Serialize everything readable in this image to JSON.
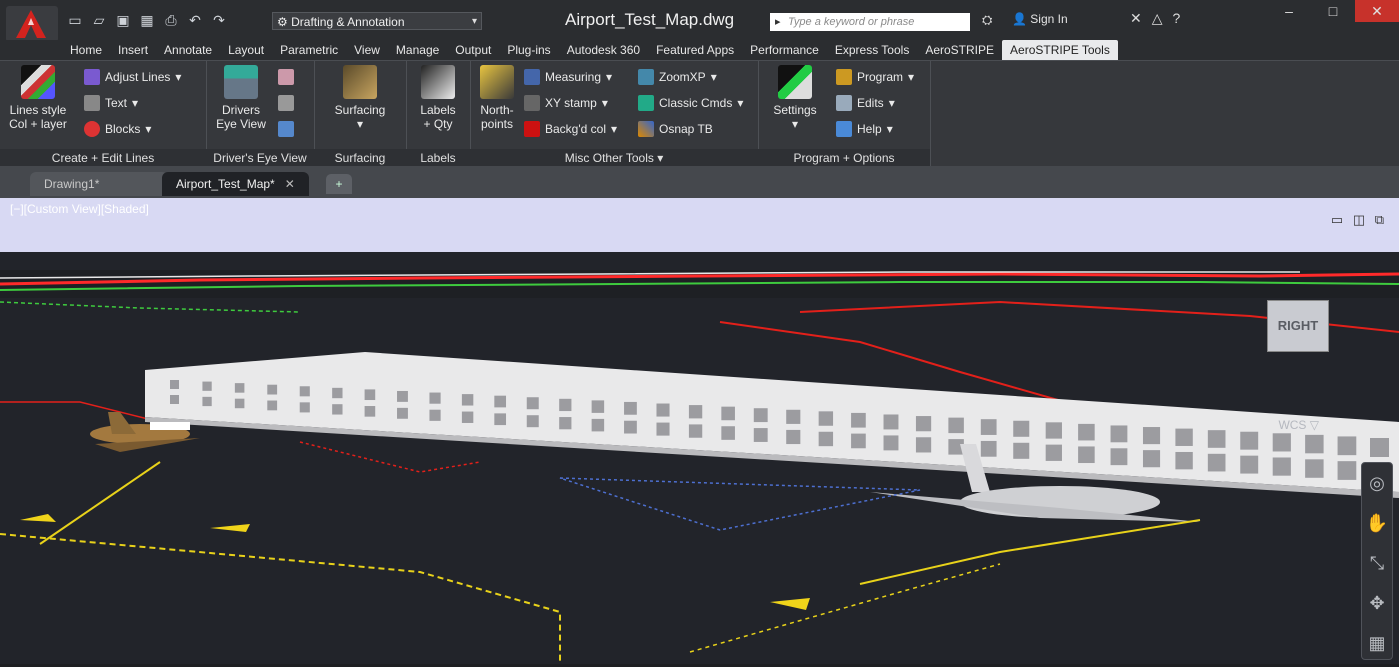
{
  "titlebar": {
    "workspace": "Drafting & Annotation",
    "doc_title": "Airport_Test_Map.dwg",
    "search_placeholder": "Type a keyword or phrase",
    "signin": "Sign In"
  },
  "ribbon_tabs": [
    "Home",
    "Insert",
    "Annotate",
    "Layout",
    "Parametric",
    "View",
    "Manage",
    "Output",
    "Plug-ins",
    "Autodesk 360",
    "Featured Apps",
    "Performance",
    "Express Tools",
    "AeroSTRIPE",
    "AeroSTRIPE Tools"
  ],
  "active_tab": "AeroSTRIPE Tools",
  "panels": {
    "create_edit": {
      "label": "Create + Edit Lines",
      "big_label_1": "Lines style",
      "big_label_2": "Col + layer",
      "adjust": "Adjust Lines",
      "text": "Text",
      "blocks": "Blocks"
    },
    "drivers": {
      "label": "Driver's Eye View",
      "big_label_1": "Drivers",
      "big_label_2": "Eye View"
    },
    "surfacing": {
      "label": "Surfacing",
      "big_label": "Surfacing"
    },
    "labels": {
      "label": "Labels",
      "big_label_1": "Labels",
      "big_label_2": "+ Qty"
    },
    "misc": {
      "label": "Misc Other Tools",
      "big_label_1": "North-",
      "big_label_2": "points",
      "measuring": "Measuring",
      "xystamp": "XY stamp",
      "backgd": "Backg'd col",
      "zoomxp": "ZoomXP",
      "classic": "Classic Cmds",
      "osnap": "Osnap TB"
    },
    "program": {
      "label": "Program + Options",
      "settings": "Settings",
      "program": "Program",
      "edits": "Edits",
      "help": "Help"
    }
  },
  "doc_tabs": {
    "drawing1": "Drawing1*",
    "airport": "Airport_Test_Map*"
  },
  "viewport": {
    "label": "[−][Custom View][Shaded]",
    "viewcube_face": "RIGHT",
    "wcs": "WCS"
  },
  "colors": {
    "background": "#22242a",
    "ribbon": "#36383c",
    "accent_red": "#e0201a",
    "viewport_header": "#d8d9f3"
  }
}
